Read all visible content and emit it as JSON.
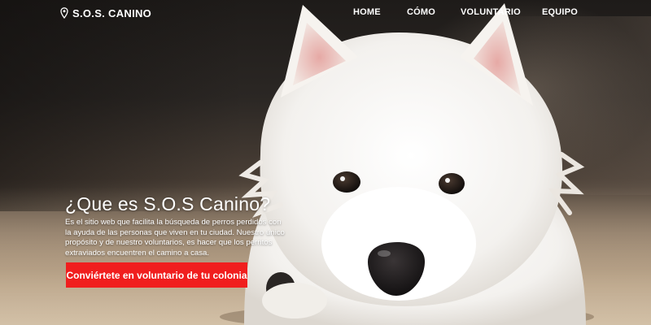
{
  "brand": {
    "name": "S.O.S. CANINO",
    "icon": "map-pin-icon"
  },
  "nav": {
    "items": [
      {
        "label": "HOME"
      },
      {
        "label": "CÓMO"
      },
      {
        "label": "VOLUNTARIO"
      },
      {
        "label": "EQUIPO"
      }
    ]
  },
  "hero": {
    "title": "¿Que es S.O.S Canino?",
    "description": "Es el sitio web que facilita la búsqueda de perros perdidos con la ayuda de las personas que viven en tu ciudad. Nuestro único propósito y de nuestro voluntarios, es hacer que los perritos extraviados encuentren el camino a casa.",
    "cta_label": "Conviértete en voluntario de tu colonia"
  },
  "colors": {
    "accent": "#f01e1e",
    "text": "#ffffff"
  }
}
